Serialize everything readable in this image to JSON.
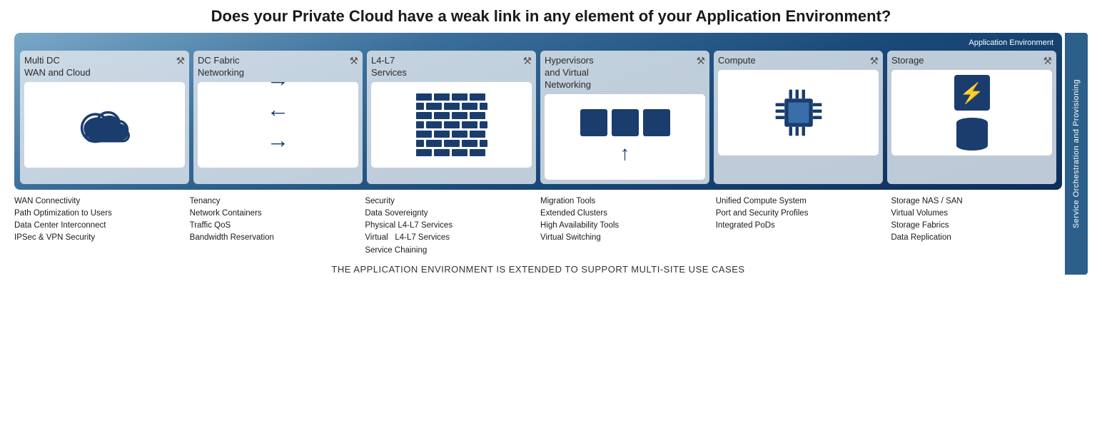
{
  "title": "Does your Private Cloud have a weak link in any element of your Application Environment?",
  "app_env_label": "Application Environment",
  "sidebar_label": "Service Orchestration and Provisioning",
  "footer": "THE APPLICATION ENVIRONMENT IS EXTENDED TO SUPPORT MULTI-SITE USE CASES",
  "cards": [
    {
      "id": "multi-dc",
      "title": "Multi DC\nWAN and Cloud",
      "icon_type": "cloud"
    },
    {
      "id": "dc-fabric",
      "title": "DC Fabric\nNetworking",
      "icon_type": "arrows"
    },
    {
      "id": "l4-l7",
      "title": "L4-L7\nServices",
      "icon_type": "bricks"
    },
    {
      "id": "hypervisors",
      "title": "Hypervisors\nand Virtual\nNetworking",
      "icon_type": "vm"
    },
    {
      "id": "compute",
      "title": "Compute",
      "icon_type": "cpu"
    },
    {
      "id": "storage",
      "title": "Storage",
      "icon_type": "storage"
    }
  ],
  "labels": [
    {
      "id": "multi-dc-labels",
      "items": [
        "WAN Connectivity",
        "Path Optimization to Users",
        "Data Center Interconnect",
        "IPSec & VPN Security"
      ]
    },
    {
      "id": "dc-fabric-labels",
      "items": [
        "Tenancy",
        "Network Containers",
        "Traffic QoS",
        "Bandwidth Reservation"
      ]
    },
    {
      "id": "l4-l7-labels",
      "items": [
        "Security",
        "Data Sovereignty",
        "Physical  L4-L7 Services",
        "Virtual    L4-L7 Services",
        "Service Chaining"
      ]
    },
    {
      "id": "hypervisors-labels",
      "items": [
        "Migration Tools",
        "Extended Clusters",
        "High Availability Tools",
        "Virtual Switching"
      ]
    },
    {
      "id": "compute-labels",
      "items": [
        "Unified Compute System",
        "Port and Security Profiles",
        "Integrated PoDs"
      ]
    },
    {
      "id": "storage-labels",
      "items": [
        "Storage NAS / SAN",
        "Virtual Volumes",
        "Storage Fabrics",
        "Data Replication"
      ]
    }
  ]
}
